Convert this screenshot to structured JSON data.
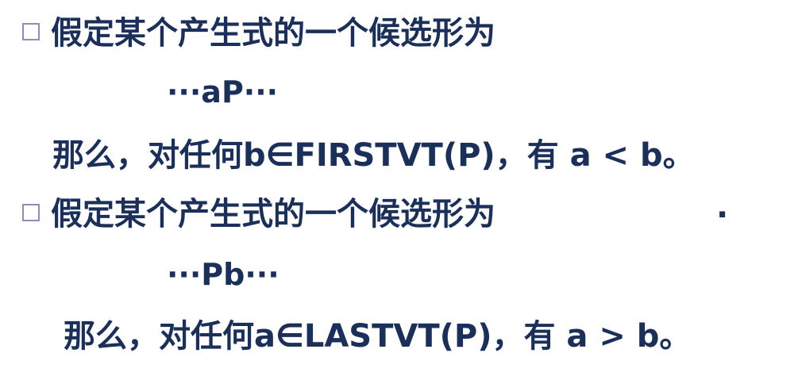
{
  "item1": {
    "bullet_icon": "hollow-square-bullet",
    "heading": "假定某个产生式的一个候选形为",
    "formula": "···aP···",
    "conclusion": "那么，对任何b∈FIRSTVT(P)，有 a < b。"
  },
  "item2": {
    "bullet_icon": "hollow-square-bullet",
    "heading": "假定某个产生式的一个候选形为",
    "formula": "···Pb···",
    "conclusion": "那么，对任何a∈LASTVT(P)，有 a > b。"
  },
  "stray_mark": "·",
  "colors": {
    "text": "#1a2f5a",
    "bullet_border": "#8b8fb8"
  }
}
